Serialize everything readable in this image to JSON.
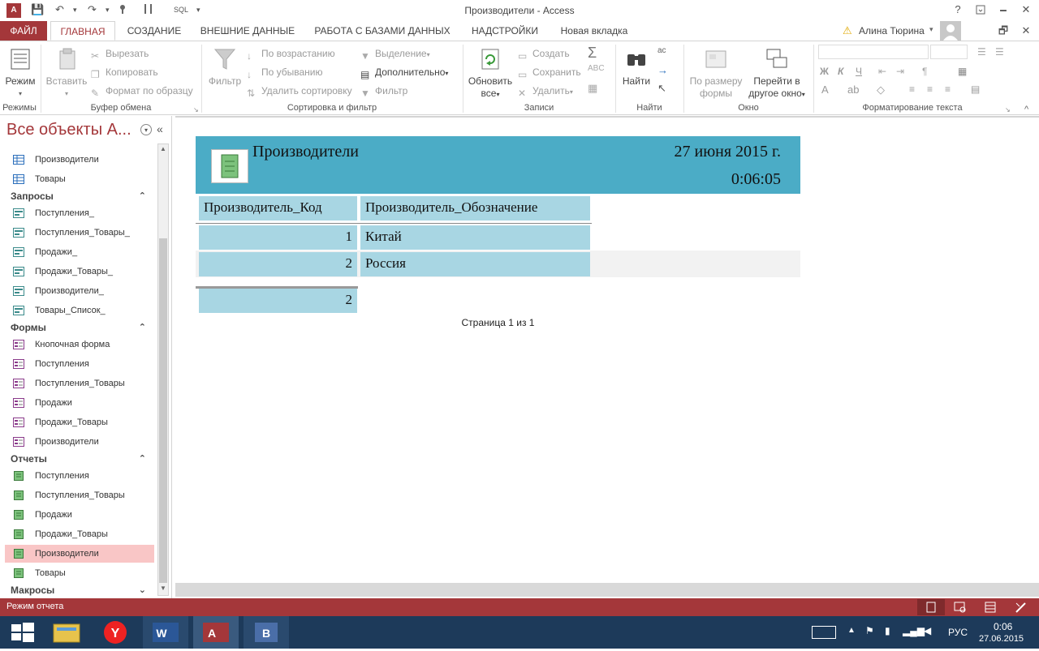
{
  "window": {
    "title": "Производители - Access",
    "app_icon": "A",
    "help": "?",
    "minimize": "🗕",
    "restore": "🗗",
    "close": "✕",
    "user": "Алина Тюрина",
    "warning_icon": "⚠",
    "restore2": "🗗",
    "close2": "✕"
  },
  "qat": {
    "save": "💾",
    "undo": "↶",
    "redo": "↷",
    "dropdown": "▾",
    "sql": "SQL"
  },
  "tabs": [
    {
      "label": "ФАЙЛ"
    },
    {
      "label": "ГЛАВНАЯ"
    },
    {
      "label": "СОЗДАНИЕ"
    },
    {
      "label": "ВНЕШНИЕ ДАННЫЕ"
    },
    {
      "label": "РАБОТА С БАЗАМИ ДАННЫХ"
    },
    {
      "label": "НАДСТРОЙКИ"
    },
    {
      "label": "Новая вкладка"
    }
  ],
  "ribbon": {
    "groups": {
      "views": "Режимы",
      "clipboard": "Буфер обмена",
      "sort_filter": "Сортировка и фильтр",
      "records": "Записи",
      "find": "Найти",
      "window": "Окно",
      "text_format": "Форматирование текста"
    },
    "views_button": "Режим",
    "paste_button": "Вставить",
    "cut": "Вырезать",
    "copy": "Копировать",
    "format_painter": "Формат по образцу",
    "filter_button": "Фильтр",
    "sort_asc": "По возрастанию",
    "sort_desc": "По убыванию",
    "remove_sort": "Удалить сортировку",
    "selection": "Выделение",
    "advanced": "Дополнительно",
    "toggle_filter": "Фильтр",
    "refresh_line1": "Обновить",
    "refresh_line2": "все",
    "new_record": "Создать",
    "save_record": "Сохранить",
    "delete_record": "Удалить",
    "find_button": "Найти",
    "fit_line1": "По размеру",
    "fit_line2": "формы",
    "switch_line1": "Перейти в",
    "switch_line2": "другое окно",
    "bold": "Ж",
    "italic": "К",
    "underline": "Ч",
    "font_color": "A"
  },
  "nav": {
    "header": "Все объекты А...",
    "collapse": "«",
    "items_top": [
      {
        "label": "Производители"
      },
      {
        "label": "Товары"
      }
    ],
    "groups": {
      "queries": "Запросы",
      "forms": "Формы",
      "reports": "Отчеты",
      "macros": "Макросы"
    },
    "queries": [
      {
        "label": "Поступления_"
      },
      {
        "label": "Поступления_Товары_"
      },
      {
        "label": "Продажи_"
      },
      {
        "label": "Продажи_Товары_"
      },
      {
        "label": "Производители_"
      },
      {
        "label": "Товары_Список_"
      }
    ],
    "forms": [
      {
        "label": "Кнопочная форма"
      },
      {
        "label": "Поступления"
      },
      {
        "label": "Поступления_Товары"
      },
      {
        "label": "Продажи"
      },
      {
        "label": "Продажи_Товары"
      },
      {
        "label": "Производители"
      }
    ],
    "reports": [
      {
        "label": "Поступления"
      },
      {
        "label": "Поступления_Товары"
      },
      {
        "label": "Продажи"
      },
      {
        "label": "Продажи_Товары"
      },
      {
        "label": "Производители"
      },
      {
        "label": "Товары"
      }
    ]
  },
  "report": {
    "title": "Производители",
    "date": "27 июня 2015 г.",
    "time": "0:06:05",
    "columns": [
      "Производитель_Код",
      "Производитель_Обозначение"
    ],
    "rows": [
      {
        "code": "1",
        "name": "Китай"
      },
      {
        "code": "2",
        "name": "Россия"
      }
    ],
    "total": "2",
    "page": "Страница 1 из 1"
  },
  "status": {
    "text": "Режим отчета"
  },
  "taskbar": {
    "lang": "РУС",
    "time": "0:06",
    "date": "27.06.2015",
    "start_label": "⊞"
  },
  "colors": {
    "accent": "#a4373a",
    "report_header": "#4bacc6",
    "report_cell": "#a8d6e3",
    "taskbar": "#1d3a5a"
  }
}
